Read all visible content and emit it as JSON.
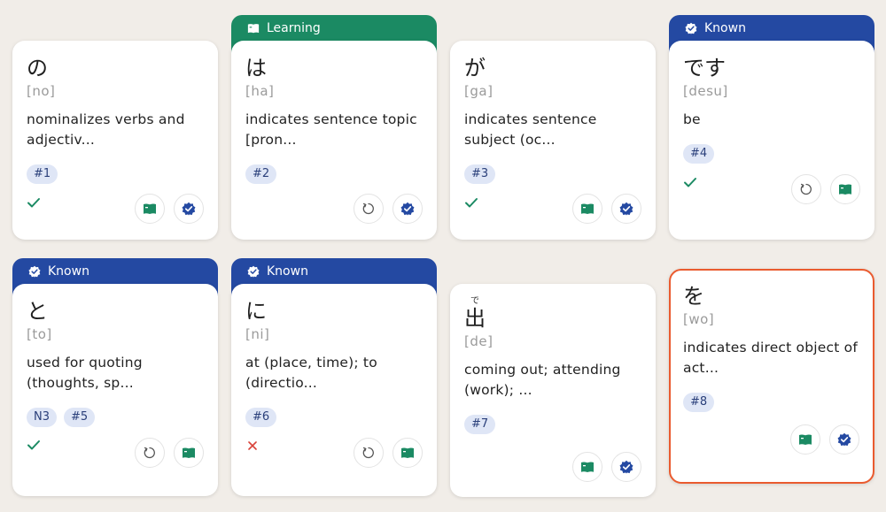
{
  "cards": [
    {
      "word": "の",
      "romaji": "[no]",
      "meaning": "nominalizes verbs and adjectiv...",
      "tags": [
        "#1"
      ],
      "status": "check",
      "banner": null,
      "actions": [
        "book-icon",
        "verified-icon"
      ]
    },
    {
      "word": "は",
      "romaji": "[ha]",
      "meaning": "indicates sentence topic [pron...",
      "tags": [
        "#2"
      ],
      "status": null,
      "banner": "Learning",
      "actions": [
        "reset-icon",
        "verified-icon"
      ]
    },
    {
      "word": "が",
      "romaji": "[ga]",
      "meaning": "indicates sentence subject (oc...",
      "tags": [
        "#3"
      ],
      "status": "check",
      "banner": null,
      "actions": [
        "book-icon",
        "verified-icon"
      ]
    },
    {
      "word": "です",
      "romaji": "[desu]",
      "meaning": "be",
      "tags": [
        "#4"
      ],
      "status": "check",
      "banner": "Known",
      "actions": [
        "reset-icon",
        "book-icon"
      ]
    },
    {
      "word": "と",
      "romaji": "[to]",
      "meaning": "used for quoting (thoughts, sp...",
      "tags": [
        "N3",
        "#5"
      ],
      "status": "check",
      "banner": "Known",
      "actions": [
        "reset-icon",
        "book-icon"
      ]
    },
    {
      "word": "に",
      "romaji": "[ni]",
      "meaning": "at (place, time); to (directio...",
      "tags": [
        "#6"
      ],
      "status": "cross",
      "banner": "Known",
      "actions": [
        "reset-icon",
        "book-icon"
      ]
    },
    {
      "word": "出",
      "furigana": "で",
      "romaji": "[de]",
      "meaning": "coming out; attending (work); ...",
      "tags": [
        "#7"
      ],
      "status": null,
      "banner": null,
      "actions": [
        "book-icon",
        "verified-icon"
      ]
    },
    {
      "word": "を",
      "romaji": "[wo]",
      "meaning": "indicates direct object of act...",
      "tags": [
        "#8"
      ],
      "status": null,
      "banner": null,
      "actions": [
        "book-icon",
        "verified-icon"
      ]
    }
  ],
  "colors": {
    "learning": "#1b8a63",
    "known": "#2449a2",
    "check": "#1b8a63",
    "cross": "#d9433a",
    "highlight_border": "#ea5b2f"
  }
}
